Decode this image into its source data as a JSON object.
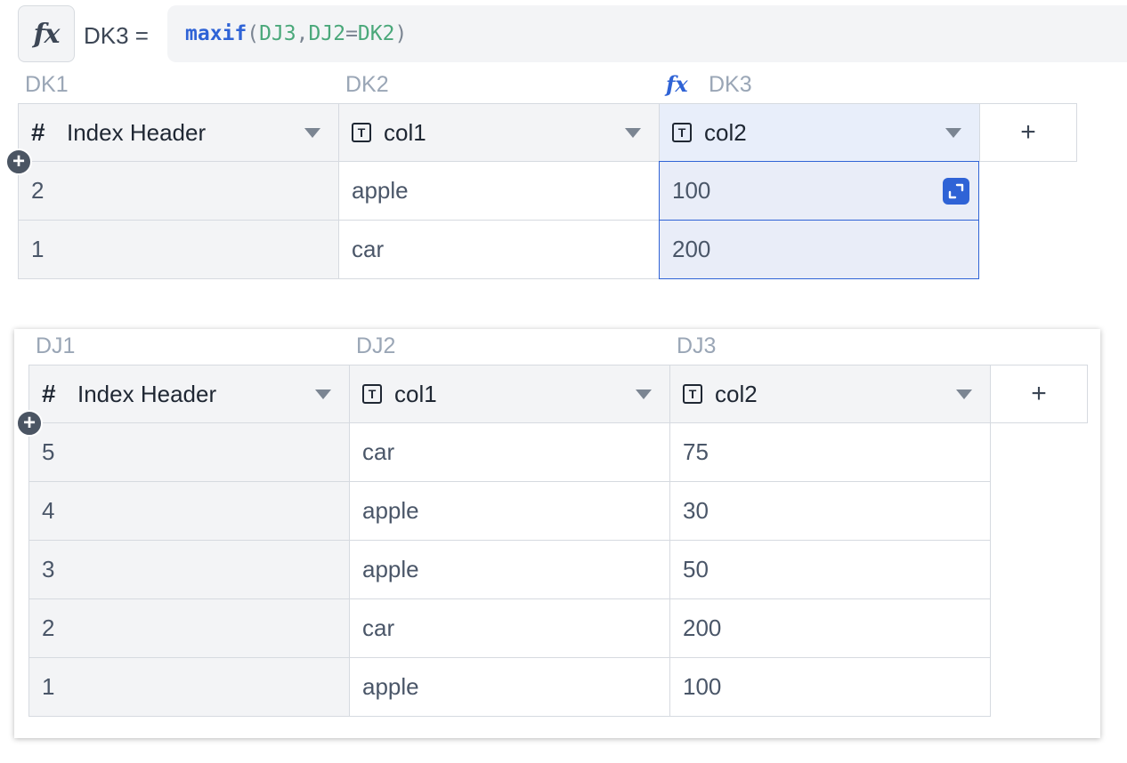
{
  "formula_bar": {
    "fx_icon": "fx-icon",
    "cell_ref": "DK3 =",
    "formula": {
      "fn": "maxif",
      "open": "(",
      "arg1": "DJ3",
      "comma": ",",
      "arg2": "DJ2",
      "eq": "=",
      "arg3": "DK2",
      "close": ")"
    }
  },
  "table_top": {
    "column_labels": [
      "DK1",
      "DK2",
      "DK3"
    ],
    "formula_column_icon": "fx-icon",
    "headers": [
      {
        "icon": "hash-icon",
        "label": "Index Header"
      },
      {
        "icon": "text-type-icon",
        "label": "col1"
      },
      {
        "icon": "text-type-icon",
        "label": "col2"
      }
    ],
    "add_column": "+",
    "rows": [
      [
        "2",
        "apple",
        "100"
      ],
      [
        "1",
        "car",
        "200"
      ]
    ]
  },
  "table_bottom": {
    "column_labels": [
      "DJ1",
      "DJ2",
      "DJ3"
    ],
    "headers": [
      {
        "icon": "hash-icon",
        "label": "Index Header"
      },
      {
        "icon": "text-type-icon",
        "label": "col1"
      },
      {
        "icon": "text-type-icon",
        "label": "col2"
      }
    ],
    "add_column": "+",
    "rows": [
      [
        "5",
        "car",
        "75"
      ],
      [
        "4",
        "apple",
        "30"
      ],
      [
        "3",
        "apple",
        "50"
      ],
      [
        "2",
        "car",
        "200"
      ],
      [
        "1",
        "apple",
        "100"
      ]
    ]
  },
  "icons": {
    "hash": "#",
    "text_type": "T",
    "add": "+",
    "fx": "fx"
  },
  "colors": {
    "accent": "#2f63d6",
    "formula_ref": "#4aa87a",
    "label": "#9aa6b6",
    "selection": "#e9edf8"
  }
}
